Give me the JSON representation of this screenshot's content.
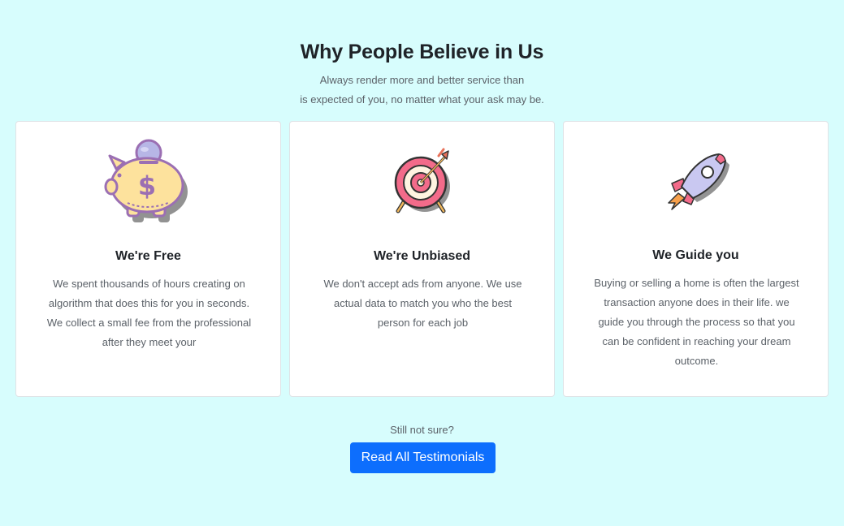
{
  "section": {
    "title": "Why People Believe in Us",
    "subtitle_line1": "Always render more and better service than",
    "subtitle_line2": "is expected of you, no matter what your ask may be."
  },
  "cards": [
    {
      "icon": "piggy-bank-icon",
      "title": "We're Free",
      "text": "We spent thousands of hours creating on algorithm that does this for you in seconds. We collect a small fee from the professional after they meet your"
    },
    {
      "icon": "target-icon",
      "title": "We're Unbiased",
      "text": "We don't accept ads from anyone. We use actual data to match you who the best person for each job"
    },
    {
      "icon": "rocket-icon",
      "title": "We Guide you",
      "text": "Buying or selling a home is often the largest transaction anyone does in their life. we guide you through the process so that you can be confident in reaching your dream outcome."
    }
  ],
  "cta": {
    "prompt": "Still not sure?",
    "button_label": "Read All Testimonials"
  },
  "colors": {
    "background": "#d7fdfd",
    "button": "#0d6efd"
  }
}
